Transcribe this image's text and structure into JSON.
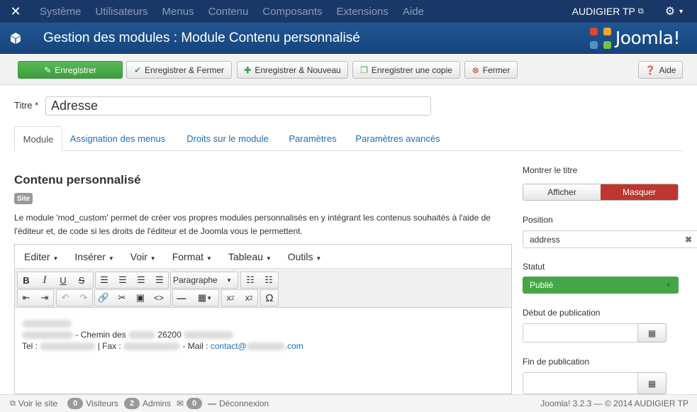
{
  "topbar": {
    "menu": [
      "Système",
      "Utilisateurs",
      "Menus",
      "Contenu",
      "Composants",
      "Extensions",
      "Aide"
    ],
    "user": "AUDIGIER TP"
  },
  "header": {
    "title": "Gestion des modules : Module Contenu personnalisé",
    "brand": "Joomla!"
  },
  "toolbar": {
    "save": "Enregistrer",
    "save_close": "Enregistrer & Fermer",
    "save_new": "Enregistrer & Nouveau",
    "save_copy": "Enregistrer une copie",
    "close": "Fermer",
    "help": "Aide"
  },
  "form": {
    "title_label": "Titre *",
    "title_value": "Adresse"
  },
  "tabs": [
    "Module",
    "Assignation des menus",
    "Droits sur le module",
    "Paramètres",
    "Paramètres avancés"
  ],
  "main": {
    "heading": "Contenu personnalisé",
    "badge": "Site",
    "description": "Le module 'mod_custom' permet de créer vos propres modules personnalisés en y intégrant les contenus souhaités à l'aide de l'éditeur et, de code si les droits de l'éditeur et de Joomla vous le permettent."
  },
  "editor": {
    "menus": [
      "Editer",
      "Insérer",
      "Voir",
      "Format",
      "Tableau",
      "Outils"
    ],
    "format_select": "Paragraphe",
    "content": {
      "line1_part1": "- Chemin des",
      "line1_part2": "26200",
      "line2_part1": "Tel :",
      "line2_part2": "| Fax :",
      "line2_part3": "- Mail :",
      "mail_prefix": "contact@",
      "mail_suffix": ".com"
    }
  },
  "side": {
    "show_title_label": "Montrer le titre",
    "show_label": "Afficher",
    "hide_label": "Masquer",
    "position_label": "Position",
    "position_value": "address",
    "status_label": "Statut",
    "status_value": "Publié",
    "start_label": "Début de publication",
    "end_label": "Fin de publication"
  },
  "statusbar": {
    "view_site": "Voir le site",
    "visitors_count": "0",
    "visitors_label": "Visiteurs",
    "admins_count": "2",
    "admins_label": "Admins",
    "messages_count": "0",
    "logout": "Déconnexion",
    "version": "Joomla! 3.2.3",
    "copyright": "— © 2014 AUDIGIER TP"
  },
  "colors": {
    "topbar": "#1a3867",
    "header": "#1c4e8a",
    "green": "#46a546",
    "red": "#bd362f",
    "link": "#1f6fb8"
  }
}
